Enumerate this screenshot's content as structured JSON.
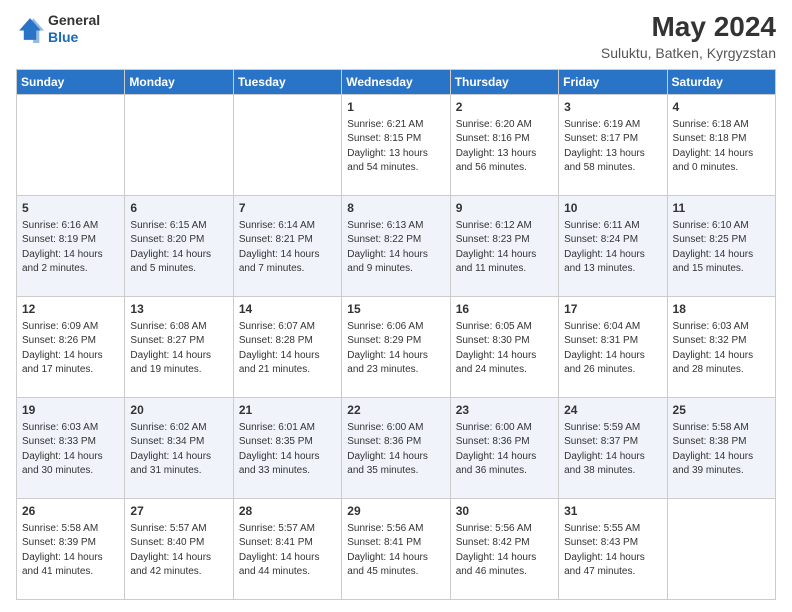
{
  "logo": {
    "general": "General",
    "blue": "Blue"
  },
  "header": {
    "month_year": "May 2024",
    "location": "Suluktu, Batken, Kyrgyzstan"
  },
  "days_of_week": [
    "Sunday",
    "Monday",
    "Tuesday",
    "Wednesday",
    "Thursday",
    "Friday",
    "Saturday"
  ],
  "weeks": [
    [
      {
        "day": "",
        "info": ""
      },
      {
        "day": "",
        "info": ""
      },
      {
        "day": "",
        "info": ""
      },
      {
        "day": "1",
        "info": "Sunrise: 6:21 AM\nSunset: 8:15 PM\nDaylight: 13 hours and 54 minutes."
      },
      {
        "day": "2",
        "info": "Sunrise: 6:20 AM\nSunset: 8:16 PM\nDaylight: 13 hours and 56 minutes."
      },
      {
        "day": "3",
        "info": "Sunrise: 6:19 AM\nSunset: 8:17 PM\nDaylight: 13 hours and 58 minutes."
      },
      {
        "day": "4",
        "info": "Sunrise: 6:18 AM\nSunset: 8:18 PM\nDaylight: 14 hours and 0 minutes."
      }
    ],
    [
      {
        "day": "5",
        "info": "Sunrise: 6:16 AM\nSunset: 8:19 PM\nDaylight: 14 hours and 2 minutes."
      },
      {
        "day": "6",
        "info": "Sunrise: 6:15 AM\nSunset: 8:20 PM\nDaylight: 14 hours and 5 minutes."
      },
      {
        "day": "7",
        "info": "Sunrise: 6:14 AM\nSunset: 8:21 PM\nDaylight: 14 hours and 7 minutes."
      },
      {
        "day": "8",
        "info": "Sunrise: 6:13 AM\nSunset: 8:22 PM\nDaylight: 14 hours and 9 minutes."
      },
      {
        "day": "9",
        "info": "Sunrise: 6:12 AM\nSunset: 8:23 PM\nDaylight: 14 hours and 11 minutes."
      },
      {
        "day": "10",
        "info": "Sunrise: 6:11 AM\nSunset: 8:24 PM\nDaylight: 14 hours and 13 minutes."
      },
      {
        "day": "11",
        "info": "Sunrise: 6:10 AM\nSunset: 8:25 PM\nDaylight: 14 hours and 15 minutes."
      }
    ],
    [
      {
        "day": "12",
        "info": "Sunrise: 6:09 AM\nSunset: 8:26 PM\nDaylight: 14 hours and 17 minutes."
      },
      {
        "day": "13",
        "info": "Sunrise: 6:08 AM\nSunset: 8:27 PM\nDaylight: 14 hours and 19 minutes."
      },
      {
        "day": "14",
        "info": "Sunrise: 6:07 AM\nSunset: 8:28 PM\nDaylight: 14 hours and 21 minutes."
      },
      {
        "day": "15",
        "info": "Sunrise: 6:06 AM\nSunset: 8:29 PM\nDaylight: 14 hours and 23 minutes."
      },
      {
        "day": "16",
        "info": "Sunrise: 6:05 AM\nSunset: 8:30 PM\nDaylight: 14 hours and 24 minutes."
      },
      {
        "day": "17",
        "info": "Sunrise: 6:04 AM\nSunset: 8:31 PM\nDaylight: 14 hours and 26 minutes."
      },
      {
        "day": "18",
        "info": "Sunrise: 6:03 AM\nSunset: 8:32 PM\nDaylight: 14 hours and 28 minutes."
      }
    ],
    [
      {
        "day": "19",
        "info": "Sunrise: 6:03 AM\nSunset: 8:33 PM\nDaylight: 14 hours and 30 minutes."
      },
      {
        "day": "20",
        "info": "Sunrise: 6:02 AM\nSunset: 8:34 PM\nDaylight: 14 hours and 31 minutes."
      },
      {
        "day": "21",
        "info": "Sunrise: 6:01 AM\nSunset: 8:35 PM\nDaylight: 14 hours and 33 minutes."
      },
      {
        "day": "22",
        "info": "Sunrise: 6:00 AM\nSunset: 8:36 PM\nDaylight: 14 hours and 35 minutes."
      },
      {
        "day": "23",
        "info": "Sunrise: 6:00 AM\nSunset: 8:36 PM\nDaylight: 14 hours and 36 minutes."
      },
      {
        "day": "24",
        "info": "Sunrise: 5:59 AM\nSunset: 8:37 PM\nDaylight: 14 hours and 38 minutes."
      },
      {
        "day": "25",
        "info": "Sunrise: 5:58 AM\nSunset: 8:38 PM\nDaylight: 14 hours and 39 minutes."
      }
    ],
    [
      {
        "day": "26",
        "info": "Sunrise: 5:58 AM\nSunset: 8:39 PM\nDaylight: 14 hours and 41 minutes."
      },
      {
        "day": "27",
        "info": "Sunrise: 5:57 AM\nSunset: 8:40 PM\nDaylight: 14 hours and 42 minutes."
      },
      {
        "day": "28",
        "info": "Sunrise: 5:57 AM\nSunset: 8:41 PM\nDaylight: 14 hours and 44 minutes."
      },
      {
        "day": "29",
        "info": "Sunrise: 5:56 AM\nSunset: 8:41 PM\nDaylight: 14 hours and 45 minutes."
      },
      {
        "day": "30",
        "info": "Sunrise: 5:56 AM\nSunset: 8:42 PM\nDaylight: 14 hours and 46 minutes."
      },
      {
        "day": "31",
        "info": "Sunrise: 5:55 AM\nSunset: 8:43 PM\nDaylight: 14 hours and 47 minutes."
      },
      {
        "day": "",
        "info": ""
      }
    ]
  ]
}
